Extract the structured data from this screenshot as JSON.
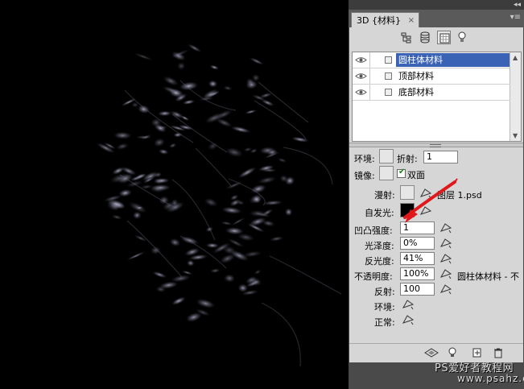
{
  "panel": {
    "tab_title": "3D {材料}",
    "close_glyph": "×",
    "collapse_glyph": "◂◂",
    "menu_glyph": "▾≡"
  },
  "toolbar": {
    "icons": [
      "scene-icon",
      "mesh-icon",
      "materials-icon",
      "lights-icon"
    ]
  },
  "materials": [
    {
      "label": "圆柱体材料",
      "selected": true
    },
    {
      "label": "顶部材料",
      "selected": false
    },
    {
      "label": "底部材料",
      "selected": false
    }
  ],
  "props": {
    "ambient_label": "环境:",
    "refraction_label": "折射:",
    "refraction_value": "1",
    "reflection_map_label": "镜像:",
    "double_sided_label": "双面",
    "double_sided_checked": true,
    "diffuse_label": "漫射:",
    "diffuse_texture": "图层 1.psd",
    "self_illum_label": "自发光:",
    "bump_label": "凹凸强度:",
    "bump_value": "1",
    "gloss_label": "光泽度:",
    "gloss_value": "0%",
    "shine_label": "反光度:",
    "shine_value": "41%",
    "opacity_label": "不透明度:",
    "opacity_value": "100%",
    "opacity_texture": "圆柱体材料 - 不",
    "reflect_label": "反射:",
    "reflect_value": "100",
    "env_label": "环境:",
    "normal_label": "正常:"
  },
  "bottom_icons": [
    "render-settings-icon",
    "light-bulb-icon",
    "new-icon",
    "delete-icon"
  ],
  "watermark": {
    "line1": "PS爱好者教程网",
    "line2": "www.psahz.com"
  },
  "colors": {
    "selection": "#3a63b5",
    "annotation_arrow": "#e0181b",
    "panel_bg": "#d6d6d6"
  }
}
